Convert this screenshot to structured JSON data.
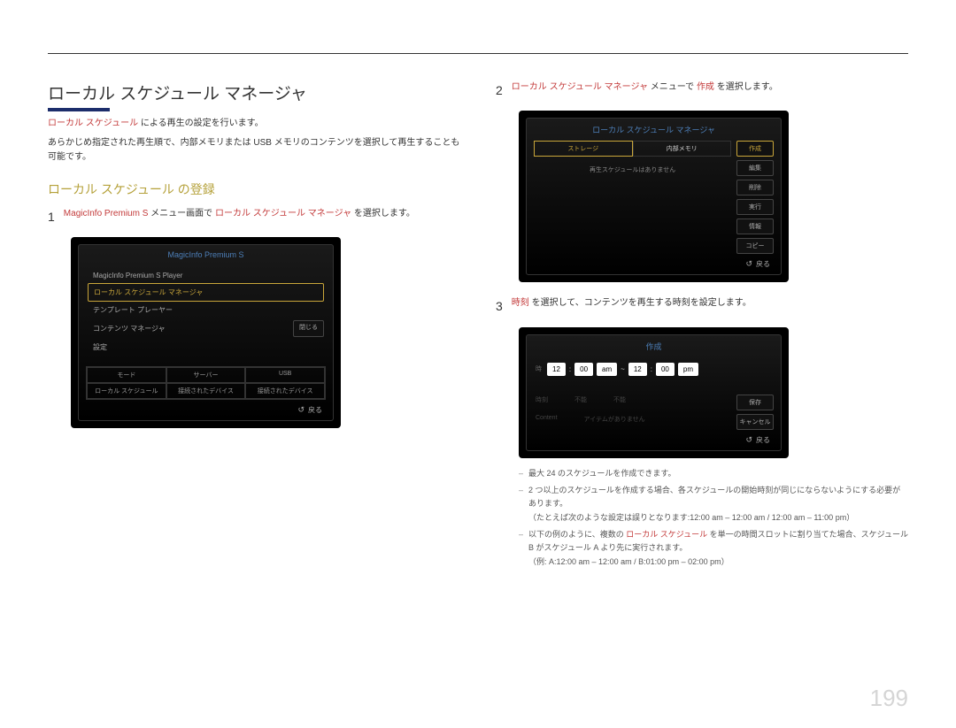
{
  "header": {},
  "left": {
    "h1": "ローカル スケジュール マネージャ",
    "lead_red": "ローカル スケジュール",
    "lead_rest": " による再生の設定を行います。",
    "lead2": "あらかじめ指定された再生順で、内部メモリまたは USB メモリのコンテンツを選択して再生することも可能です。",
    "h2": "ローカル スケジュール の登録",
    "step1_num": "1",
    "step1_a": "MagicInfo Premium S",
    "step1_b": " メニュー画面で ",
    "step1_c": "ローカル スケジュール マネージャ",
    "step1_d": " を選択します。",
    "panel1": {
      "title": "MagicInfo Premium S",
      "items": [
        "MagicInfo Premium S Player",
        "ローカル スケジュール マネージャ",
        "テンプレート プレーヤー",
        "コンテンツ マネージャ",
        "設定"
      ],
      "close": "閉じる",
      "grid": [
        "モード",
        "サーバー",
        "USB",
        "ローカル スケジュール",
        "接続されたデバイス",
        "接続されたデバイス"
      ],
      "return": "戻る"
    }
  },
  "right": {
    "step2_num": "2",
    "step2_a": "ローカル スケジュール マネージャ",
    "step2_b": " メニューで ",
    "step2_c": "作成",
    "step2_d": " を選択します。",
    "panel2": {
      "title": "ローカル スケジュール マネージャ",
      "tab1": "ストレージ",
      "tab2": "内部メモリ",
      "msg": "再生スケジュールはありません",
      "btns": [
        "作成",
        "編集",
        "削除",
        "実行",
        "情報",
        "コピー"
      ],
      "return": "戻る"
    },
    "step3_num": "3",
    "step3_a": "時刻",
    "step3_b": " を選択して、コンテンツを再生する時刻を設定します。",
    "panel3": {
      "title": "作成",
      "tlabel": "時",
      "h1": "12",
      "m1": "00",
      "ap1": "am",
      "tilde": "~",
      "h2": "12",
      "m2": "00",
      "ap2": "pm",
      "row2a": "時刻",
      "row2b": "不能",
      "row2c": "不能",
      "row3a": "Content",
      "row3b": "アイテムがありません",
      "btn_save": "保存",
      "btn_cancel": "キャンセル",
      "return": "戻る"
    },
    "notes": {
      "n1": "最大 24 のスケジュールを作成できます。",
      "n2": "2 つ以上のスケジュールを作成する場合、各スケジュールの開始時刻が同じにならないようにする必要があります。",
      "n2b": "（たとえば次のような設定は誤りとなります:12:00 am – 12:00 am / 12:00 am – 11:00 pm）",
      "n3a": "以下の例のように、複数の ",
      "n3b": "ローカル スケジュール",
      "n3c": " を単一の時間スロットに割り当てた場合、スケジュール B がスケジュール A より先に実行されます。",
      "n3d": "（例: A:12:00 am – 12:00 am / B:01:00 pm – 02:00 pm）"
    }
  },
  "pagenum": "199"
}
